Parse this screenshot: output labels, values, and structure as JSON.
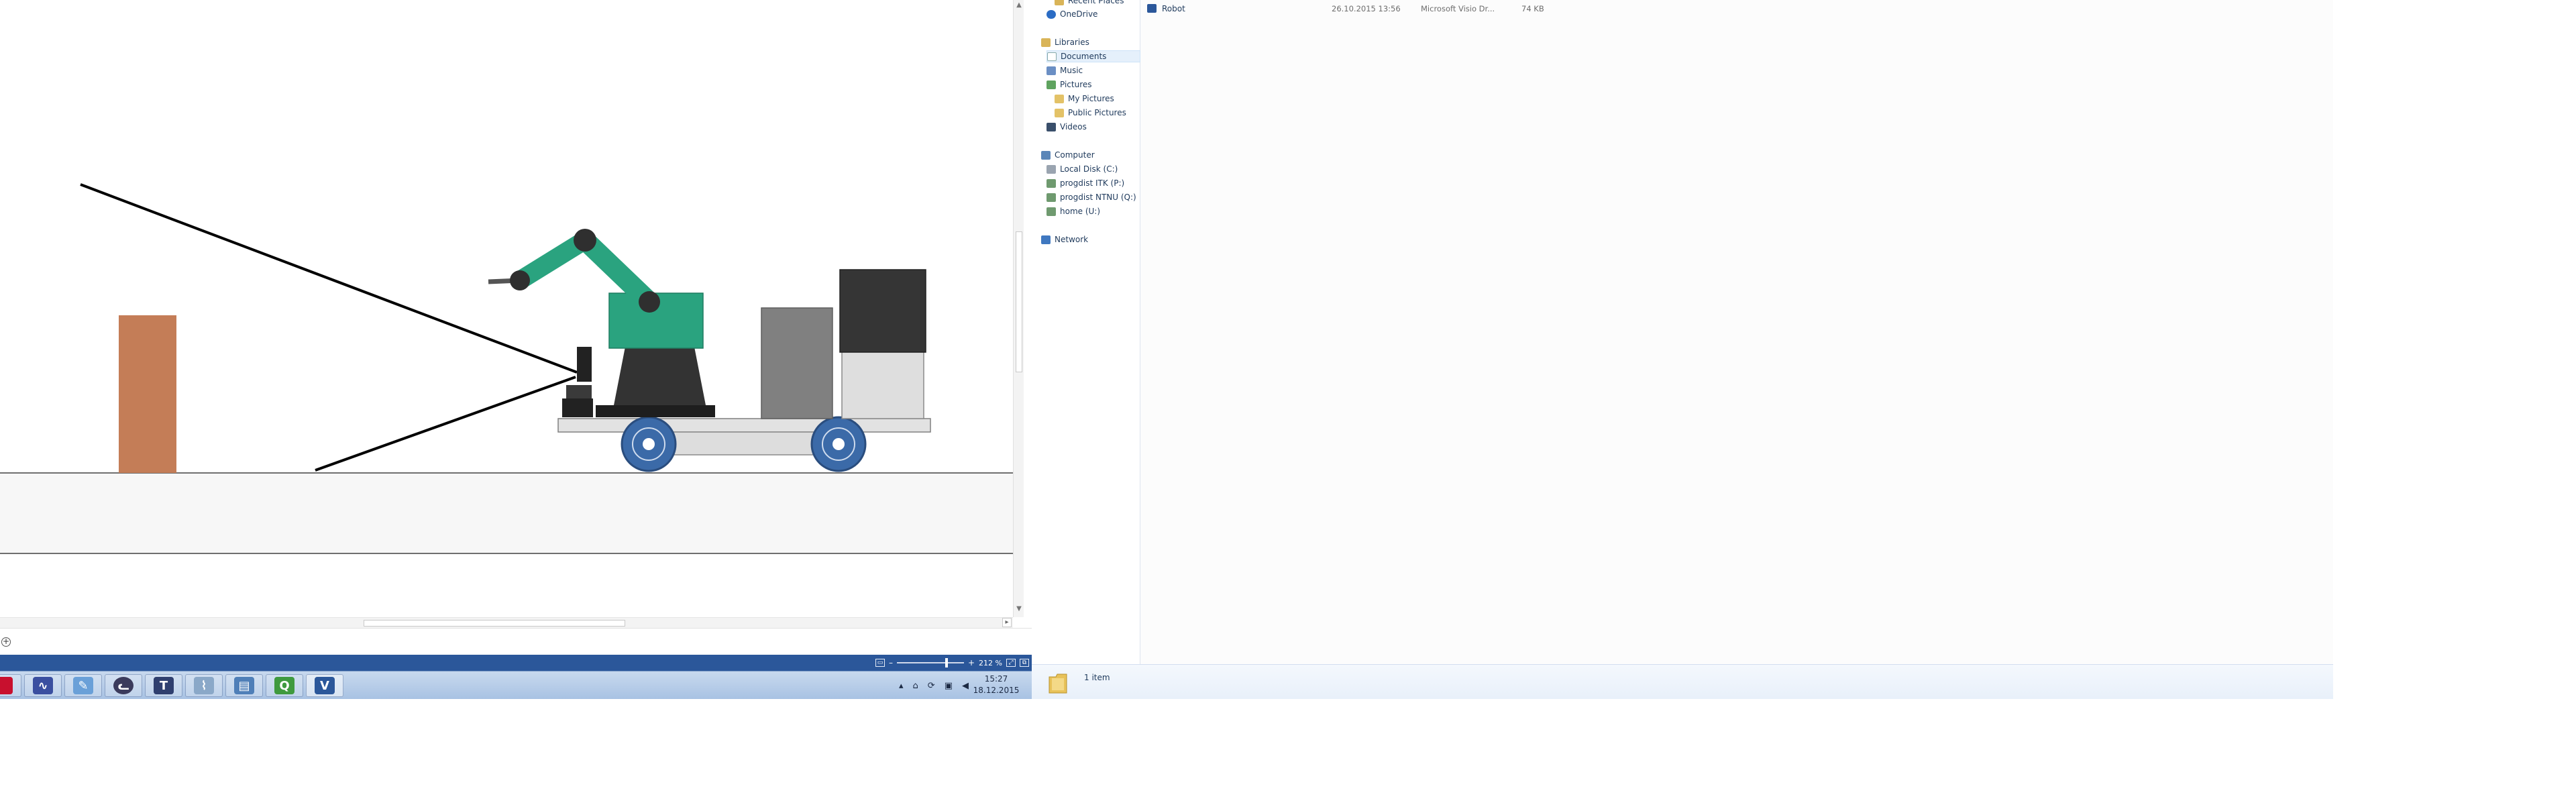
{
  "explorer": {
    "nav": {
      "recent_places": "Recent Places",
      "onedrive": "OneDrive",
      "libraries": "Libraries",
      "documents": "Documents",
      "music": "Music",
      "pictures": "Pictures",
      "my_pictures": "My Pictures",
      "public_pictures": "Public Pictures",
      "videos": "Videos",
      "computer": "Computer",
      "local_disk": "Local Disk (C:)",
      "progdist_itk": "progdist ITK (P:)",
      "progdist_ntnu": "progdist NTNU (Q:)",
      "home": "home (U:)",
      "network": "Network"
    },
    "files": [
      {
        "name": "Robot",
        "date": "26.10.2015 13:56",
        "type": "Microsoft Visio Dr...",
        "size": "74 KB"
      }
    ],
    "details": {
      "count": "1 item"
    }
  },
  "visio": {
    "status": {
      "zoom": "212 %"
    }
  },
  "taskbar": {
    "apps": [
      {
        "name": "acrobat",
        "glyph": "",
        "color": "#c8102e"
      },
      {
        "name": "matlab",
        "glyph": "",
        "color": "#3a4fa0"
      },
      {
        "name": "paint",
        "glyph": "",
        "color": "#6aa0d8"
      },
      {
        "name": "cat-app",
        "glyph": "",
        "color": "#3b3b5c"
      },
      {
        "name": "texmaker",
        "glyph": "T",
        "color": "#2f3f6f"
      },
      {
        "name": "brush-app",
        "glyph": "",
        "color": "#8aa8c8"
      },
      {
        "name": "explorer",
        "glyph": "",
        "color": "#4f7fb8"
      },
      {
        "name": "qt-creator",
        "glyph": "Q",
        "color": "#3f9a3f"
      },
      {
        "name": "visio",
        "glyph": "V",
        "color": "#2b579a"
      }
    ],
    "clock": {
      "time": "15:27",
      "date": "18.12.2015"
    }
  }
}
